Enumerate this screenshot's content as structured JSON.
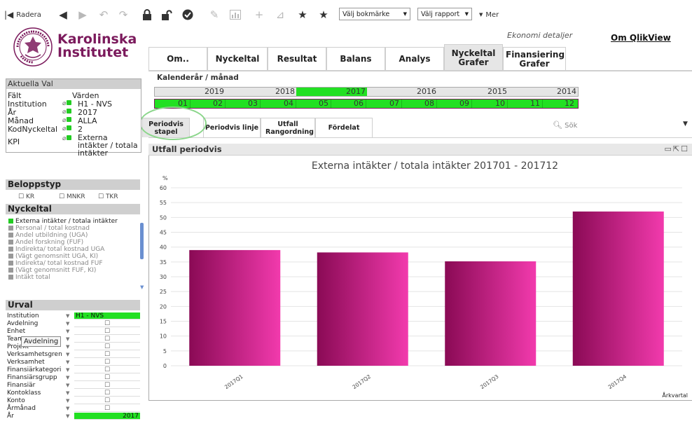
{
  "toolbar": {
    "clear_label": "Radera",
    "bookmark_select": "Välj bokmärke",
    "report_select": "Välj rapport",
    "more_label": "Mer"
  },
  "logo": {
    "line1": "Karolinska",
    "line2": "Institutet",
    "seal_text": "KAROLINSKA INSTITUTET ANNO 1810"
  },
  "header": {
    "subtitle": "Ekonomi detaljer",
    "om_qlikview": "Om QlikView"
  },
  "main_tabs": [
    {
      "label": "Om..",
      "active": false
    },
    {
      "label": "Nyckeltal",
      "active": false
    },
    {
      "label": "Resultat",
      "active": false
    },
    {
      "label": "Balans",
      "active": false
    },
    {
      "label": "Analys",
      "active": false
    },
    {
      "label": "Nyckeltal Grafer",
      "active": true
    },
    {
      "label": "Finansiering Grafer",
      "active": false
    }
  ],
  "calendar": {
    "label": "Kalenderår / månad",
    "years": [
      "2019",
      "2018",
      "2017",
      "2016",
      "2015",
      "2014"
    ],
    "selected_year": "2017",
    "months": [
      "01",
      "02",
      "03",
      "04",
      "05",
      "06",
      "07",
      "08",
      "09",
      "10",
      "11",
      "12"
    ]
  },
  "sub_tabs": [
    {
      "label": "Periodvis stapel",
      "active": true
    },
    {
      "label": "Periodvis linje",
      "active": false
    },
    {
      "label": "Utfall Rangordning",
      "active": false
    },
    {
      "label": "Fördelat",
      "active": false
    }
  ],
  "search": {
    "label": "Sök"
  },
  "chart_panel": {
    "header_title": "Utfall periodvis"
  },
  "chart_data": {
    "type": "bar",
    "title": "Externa intäkter / totala intäkter 201701 - 201712",
    "ylabel": "%",
    "xlabel": "Årkvartal",
    "categories": [
      "2017Q1",
      "2017Q2",
      "2017Q3",
      "2017Q4"
    ],
    "values": [
      39,
      38.2,
      35.2,
      52
    ],
    "ylim": [
      0,
      60
    ],
    "yticks": [
      "0",
      "5",
      "10",
      "15",
      "20",
      "25",
      "30",
      "35",
      "40",
      "45",
      "50",
      "55",
      "60"
    ],
    "grid": true,
    "bar_gradient": [
      "#8a0a55",
      "#f23aad"
    ]
  },
  "aktuella_val": {
    "title": "Aktuella Val",
    "col_field": "Fält",
    "col_values": "Värden",
    "rows": [
      {
        "field": "Institution",
        "value": "H1 - NVS"
      },
      {
        "field": "År",
        "value": "2017"
      },
      {
        "field": "Månad",
        "value": "ALLA"
      },
      {
        "field": "KodNyckeltal",
        "value": "2"
      },
      {
        "field": "KPI",
        "value": "Externa intäkter / totala intäkter"
      }
    ]
  },
  "beloppstyp": {
    "title": "Beloppstyp",
    "options": [
      "KR",
      "MNKR",
      "TKR"
    ]
  },
  "nyckeltal": {
    "title": "Nyckeltal",
    "items": [
      {
        "label": "Externa intäkter / totala intäkter",
        "selected": true
      },
      {
        "label": "Personal / total kostnad",
        "selected": false
      },
      {
        "label": "Andel utbildning (UGA)",
        "selected": false
      },
      {
        "label": "Andel forskning (FUF)",
        "selected": false
      },
      {
        "label": "Indirekta/ total kostnad UGA",
        "selected": false
      },
      {
        "label": "(Vägt genomsnitt UGA, KI)",
        "selected": false
      },
      {
        "label": "Indirekta/ total kostnad FUF",
        "selected": false
      },
      {
        "label": "(Vägt genomsnitt FUF, KI)",
        "selected": false
      },
      {
        "label": "Intäkt total",
        "selected": false
      }
    ]
  },
  "urval": {
    "title": "Urval",
    "rows": [
      {
        "label": "Institution",
        "value": "H1 - NVS"
      },
      {
        "label": "Avdelning",
        "value": ""
      },
      {
        "label": "Enhet",
        "value": ""
      },
      {
        "label": "Team",
        "value": ""
      },
      {
        "label": "Projekt",
        "value": ""
      },
      {
        "label": "Verksamhetsgren",
        "value": ""
      },
      {
        "label": "Verksamhet",
        "value": ""
      },
      {
        "label": "Finansiärkategori",
        "value": ""
      },
      {
        "label": "Finansiärsgrupp",
        "value": ""
      },
      {
        "label": "Finansiär",
        "value": ""
      },
      {
        "label": "Kontoklass",
        "value": ""
      },
      {
        "label": "Konto",
        "value": ""
      },
      {
        "label": "Årmånad",
        "value": ""
      },
      {
        "label": "År",
        "value": "2017"
      }
    ],
    "tooltip": "Avdelning"
  },
  "icons": [
    "clear-first-icon",
    "back-icon",
    "forward-icon",
    "undo-icon",
    "redo-icon",
    "lock-icon",
    "unlock-icon",
    "check-icon",
    "edit-icon",
    "chart-icon",
    "add-icon",
    "filter-icon",
    "bookmark-add-icon",
    "bookmark-icon"
  ]
}
